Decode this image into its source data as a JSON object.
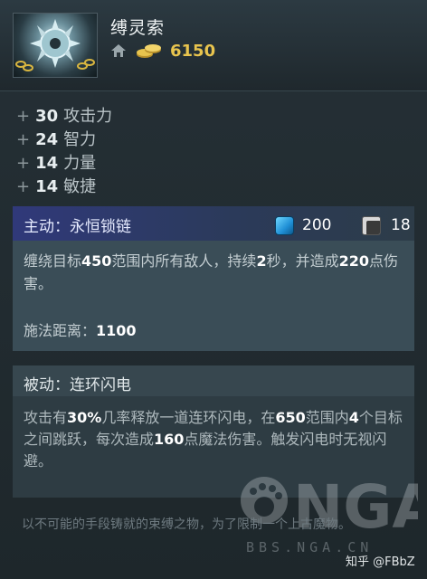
{
  "item": {
    "name": "缚灵索",
    "cost": "6150",
    "icon": "chained-spiked-orb-icon"
  },
  "stats": [
    {
      "sign": "+",
      "value": "30",
      "name": "攻击力"
    },
    {
      "sign": "+",
      "value": "24",
      "name": "智力"
    },
    {
      "sign": "+",
      "value": "14",
      "name": "力量"
    },
    {
      "sign": "+",
      "value": "14",
      "name": "敏捷"
    }
  ],
  "active": {
    "title": "主动：永恒锁链",
    "mana": "200",
    "cooldown": "18",
    "desc": [
      "缠绕目标",
      "450",
      "范围内所有敌人，持续",
      "2",
      "秒，并造成",
      "220",
      "点伤害。"
    ],
    "range_label": "施法距离：",
    "range_value": "1100"
  },
  "passive": {
    "title": "被动：连环闪电",
    "desc": [
      "攻击有",
      "30%",
      "几率释放一道连环闪电，在",
      "650",
      "范围内",
      "4",
      "个目标之间跳跃，每次造成",
      "160",
      "点魔法伤害。触发闪电时无视闪避。"
    ]
  },
  "lore": "以不可能的手段铸就的束缚之物，为了限制一个上古魔物。",
  "watermark": {
    "logo": "NGA",
    "url": "BBS.NGA.CN"
  },
  "credit": "知乎 @FBbZ",
  "colors": {
    "gold": "#e8c44e",
    "active_header": "#30397a",
    "mana": "#1f8fd6"
  }
}
